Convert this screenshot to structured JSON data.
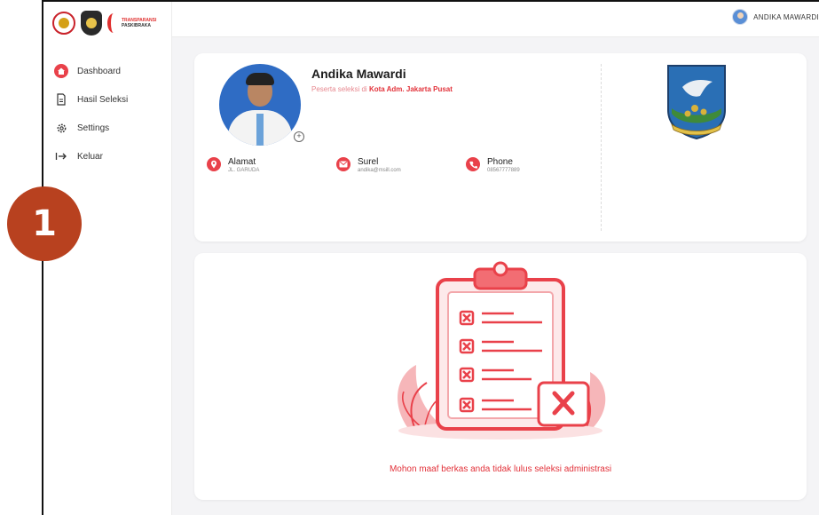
{
  "brand": {
    "logo_text_line1": "TRANSPARANSI",
    "logo_text_line2": "PASKIBRAKA",
    "accent": "#e9414a"
  },
  "header": {
    "user_name": "ANDIKA MAWARDI",
    "avatar_icon": "avatar"
  },
  "sidebar": {
    "items": [
      {
        "label": "Dashboard",
        "icon": "home-icon",
        "active": true
      },
      {
        "label": "Hasil Seleksi",
        "icon": "document-icon",
        "active": false
      },
      {
        "label": "Settings",
        "icon": "gear-icon",
        "active": false
      },
      {
        "label": "Keluar",
        "icon": "logout-icon",
        "active": false
      }
    ]
  },
  "profile": {
    "name": "Andika Mawardi",
    "subtitle_prefix": "Peserta seleksi di",
    "subtitle_location": "Kota Adm. Jakarta Pusat",
    "fields": [
      {
        "label": "Alamat",
        "value": "JL. GARUDA",
        "icon": "location-icon"
      },
      {
        "label": "Surel",
        "value": "andika@msill.com",
        "icon": "mail-icon"
      },
      {
        "label": "Phone",
        "value": "08567777889",
        "icon": "phone-icon"
      }
    ]
  },
  "result": {
    "message": "Mohon maaf berkas anda tidak lulus seleksi administrasi"
  },
  "overlay": {
    "step_number": "1"
  }
}
